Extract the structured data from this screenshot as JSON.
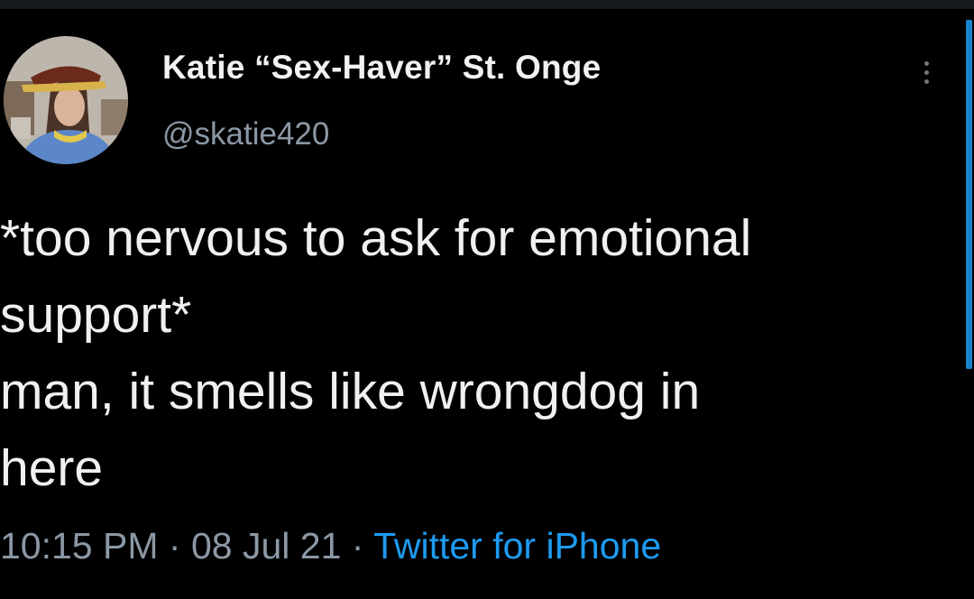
{
  "tweet": {
    "author": {
      "display_name": "Katie “Sex-Haver” St. Onge",
      "handle": "@skatie420",
      "avatar_icon": "profile-photo"
    },
    "text_lines": [
      "*too nervous to ask for emotional",
      "support*",
      "man, it smells like wrongdog in",
      "here"
    ],
    "time": "10:15 PM",
    "date": "08 Jul 21",
    "separator": "·",
    "source": "Twitter for iPhone",
    "more_icon": "more-vertical-icon"
  },
  "colors": {
    "background": "#000000",
    "text": "#f0f0f0",
    "secondary": "#8b98a5",
    "link": "#1d9bf0"
  }
}
